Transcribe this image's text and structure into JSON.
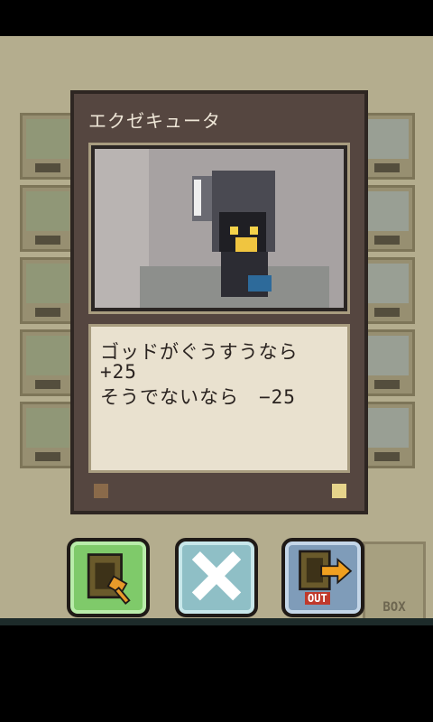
{
  "card": {
    "title": "エクゼキュータ",
    "effect_line1": "ゴッドがぐうすうなら",
    "effect_line2": "+25",
    "effect_line3": "そうでないなら　−25"
  },
  "actions": {
    "out_label": "OUT"
  },
  "background_boxes": {
    "box_label": "BOX"
  },
  "colors": {
    "card_frame": "#554640",
    "text_panel": "#e9e1cf",
    "use_button": "#7fca6a",
    "cancel_button": "#8fbfc6",
    "out_button": "#7f9cb9"
  }
}
